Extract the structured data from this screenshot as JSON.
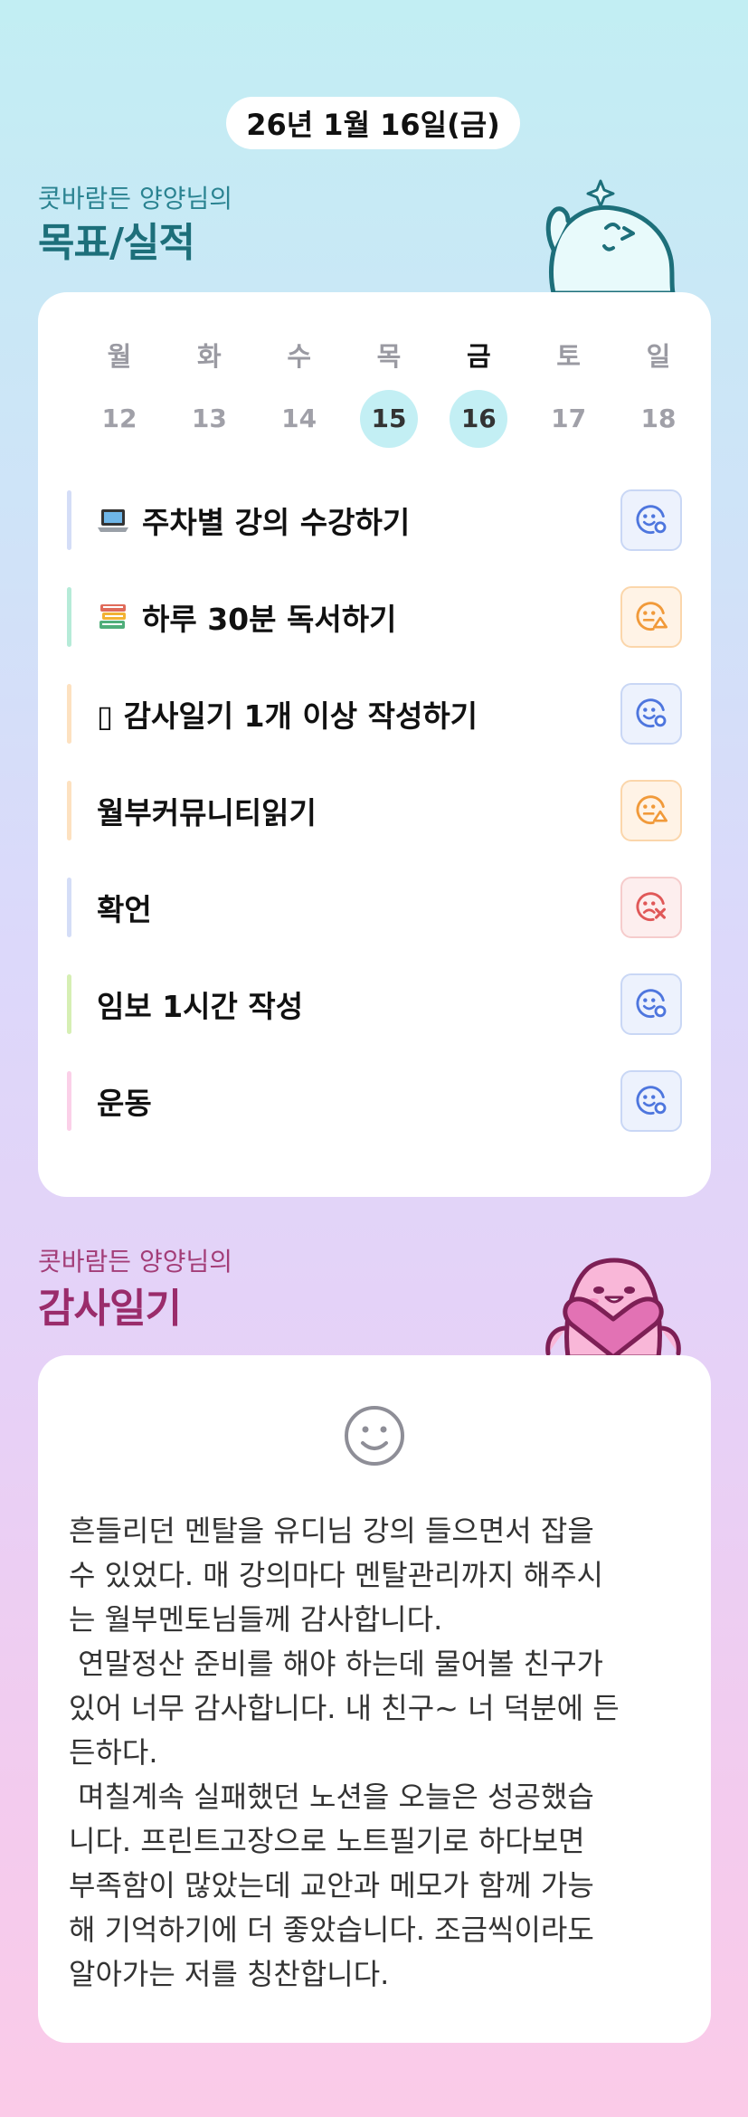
{
  "header": {
    "date": "26년 1월 16일(금)"
  },
  "goals_section": {
    "subtitle": "콧바람든 양양님의",
    "title": "목표/실적"
  },
  "week": {
    "days": [
      {
        "label": "월",
        "date": "12",
        "today": false,
        "highlight": false
      },
      {
        "label": "화",
        "date": "13",
        "today": false,
        "highlight": false
      },
      {
        "label": "수",
        "date": "14",
        "today": false,
        "highlight": false
      },
      {
        "label": "목",
        "date": "15",
        "today": false,
        "highlight": true
      },
      {
        "label": "금",
        "date": "16",
        "today": true,
        "highlight": true
      },
      {
        "label": "토",
        "date": "17",
        "today": false,
        "highlight": false
      },
      {
        "label": "일",
        "date": "18",
        "today": false,
        "highlight": false
      }
    ]
  },
  "goals": [
    {
      "emoji": "laptop-icon",
      "text": "주차별 강의 수강하기",
      "bar_color": "#d4ddf7",
      "status": "done"
    },
    {
      "emoji": "books-icon",
      "text": "하루 30분 독서하기",
      "bar_color": "#b6ebd8",
      "status": "partial"
    },
    {
      "emoji": "missing-glyph-icon",
      "text": "▯ 감사일기 1개 이상 작성하기",
      "bar_color": "#fde1c0",
      "status": "done"
    },
    {
      "emoji": "",
      "text": "월부커뮤니티읽기",
      "bar_color": "#fde1c0",
      "status": "partial"
    },
    {
      "emoji": "",
      "text": "확언",
      "bar_color": "#d4ddf7",
      "status": "fail"
    },
    {
      "emoji": "",
      "text": "임보 1시간 작성",
      "bar_color": "#d6efb4",
      "status": "done"
    },
    {
      "emoji": "",
      "text": "운동",
      "bar_color": "#fbd0e8",
      "status": "done"
    }
  ],
  "status_colors": {
    "done": {
      "bg": "#edf2fd",
      "border": "#c9d7f5",
      "fg": "#4e76de"
    },
    "partial": {
      "bg": "#fff3e6",
      "border": "#fbd6ab",
      "fg": "#f19a3a"
    },
    "fail": {
      "bg": "#fdeeee",
      "border": "#f6cccc",
      "fg": "#e05858"
    }
  },
  "gratitude_section": {
    "subtitle": "콧바람든 양양님의",
    "title": "감사일기",
    "mood_icon": "smile-icon",
    "text": "흔들리던 멘탈을 유디님 강의 들으면서 잡을\n수 있었다. 매 강의마다 멘탈관리까지 해주시\n는 월부멘토님들께 감사합니다.\n 연말정산 준비를 해야 하는데 물어볼 친구가\n있어 너무 감사합니다. 내 친구~ 너 덕분에 든\n든하다.\n 며칠계속 실패했던 노션을 오늘은 성공했습\n니다. 프린트고장으로 노트필기로 하다보면\n부족함이 많았는데 교안과 메모가 함께 가능\n해 기억하기에 더 좋았습니다. 조금씩이라도\n알아가는 저를 칭찬합니다."
  },
  "colors": {
    "goals_title": "#1d6f7a",
    "gratitude_title": "#9a2c6b"
  }
}
